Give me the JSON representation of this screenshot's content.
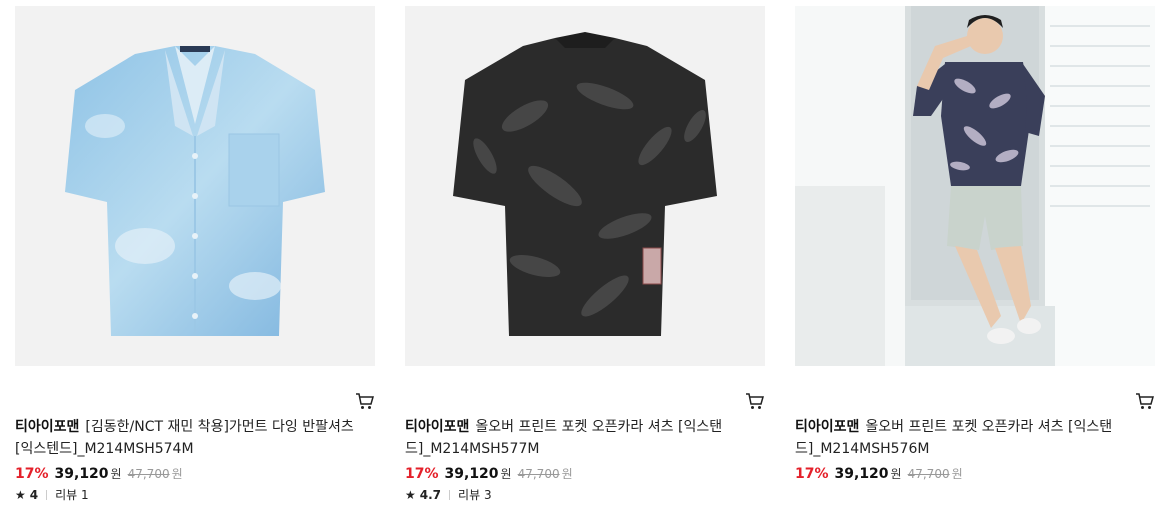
{
  "products": [
    {
      "brand": "티아이포맨",
      "title": "[김동한/NCT 재민 착용]가먼트 다잉 반팔셔츠 [익스텐드]_M214MSH574M",
      "discount": "17%",
      "price": "39,120",
      "won": "원",
      "original_price": "47,700",
      "original_won": "원",
      "rating": "4",
      "review_label": "리뷰",
      "review_count": "1",
      "image": "light-blue-tie-dye-shirt"
    },
    {
      "brand": "티아이포맨",
      "title": "올오버 프린트 포켓 오픈카라 셔츠 [익스탠드]_M214MSH577M",
      "discount": "17%",
      "price": "39,120",
      "won": "원",
      "original_price": "47,700",
      "original_won": "원",
      "rating": "4.7",
      "review_label": "리뷰",
      "review_count": "3",
      "image": "black-floral-print-shirt-back"
    },
    {
      "brand": "티아이포맨",
      "title": "올오버 프린트 포켓 오픈카라 셔츠 [익스탠드]_M214MSH576M",
      "discount": "17%",
      "price": "39,120",
      "won": "원",
      "original_price": "47,700",
      "original_won": "원",
      "image": "model-wearing-print-shirt"
    }
  ],
  "icons": {
    "cart": "cart-icon",
    "star": "star-icon"
  },
  "colors": {
    "discount": "#e4202a",
    "text": "#111111",
    "muted": "#999999"
  }
}
